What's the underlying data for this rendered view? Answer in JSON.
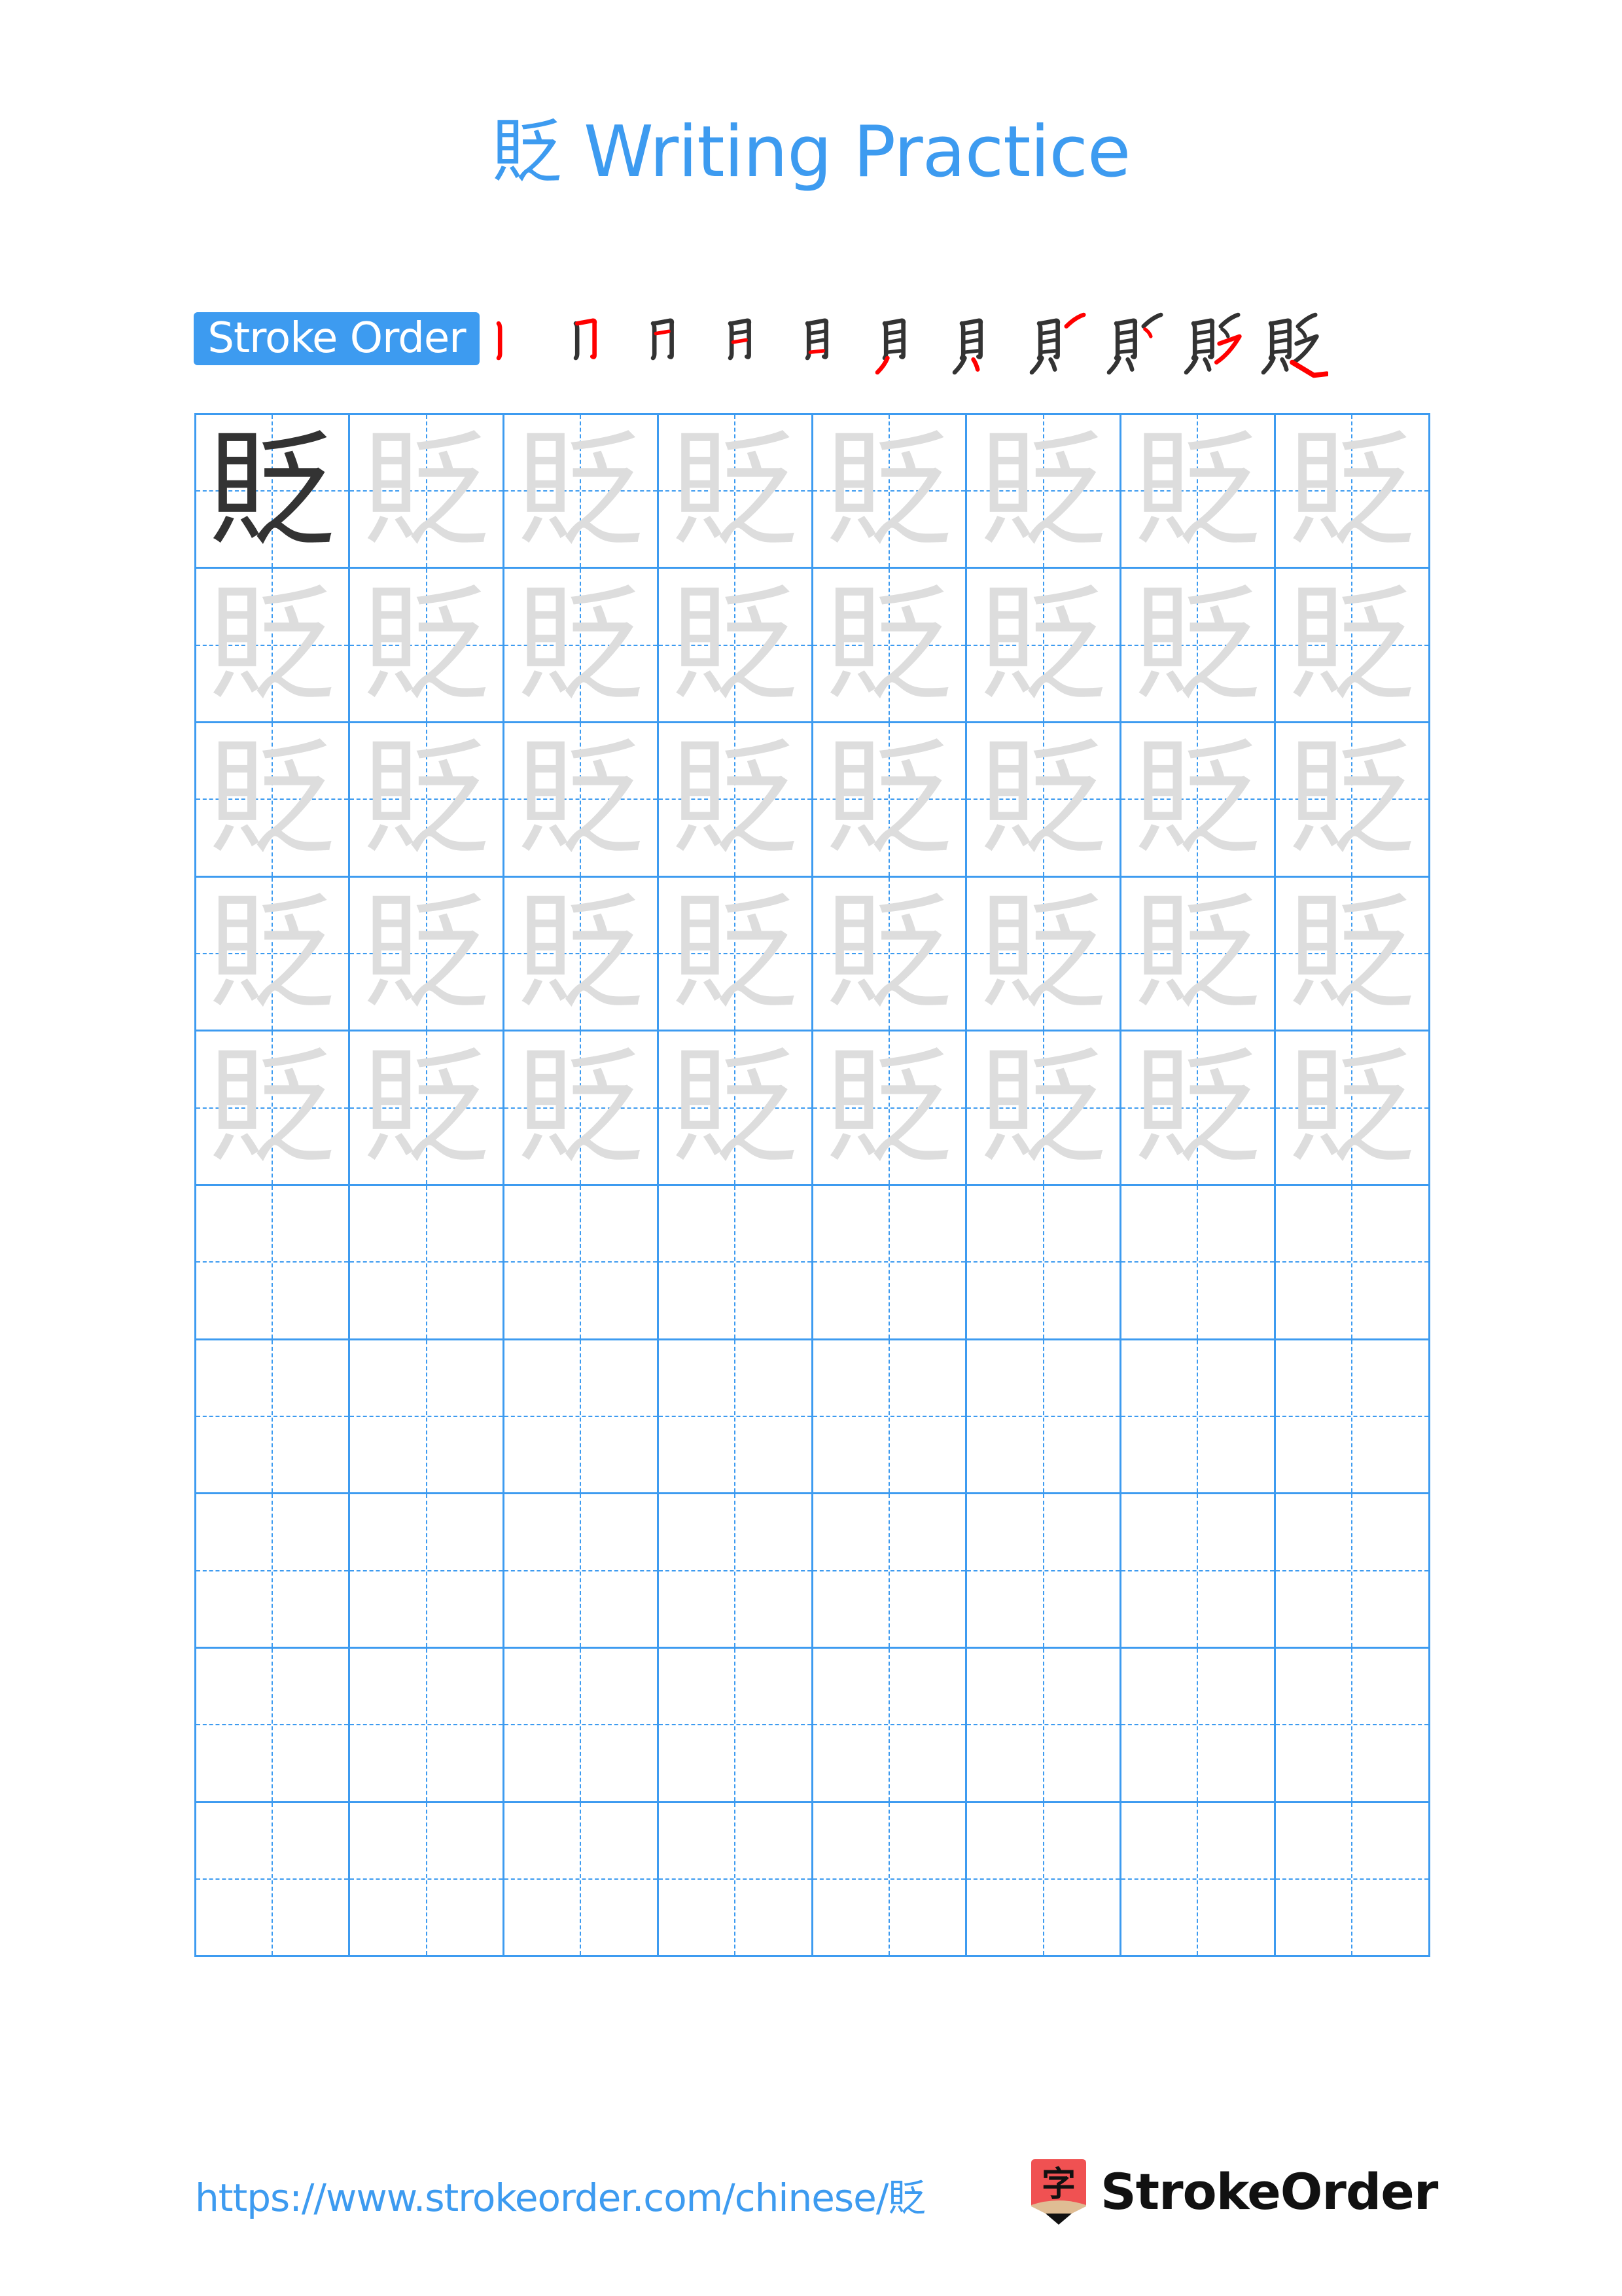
{
  "title": "貶 Writing Practice",
  "character": "貶",
  "stroke_order": {
    "label": "Stroke Order",
    "total_strokes": 11,
    "frames": [
      {
        "step": 1,
        "highlight_stroke": 1
      },
      {
        "step": 2,
        "highlight_stroke": 2
      },
      {
        "step": 3,
        "highlight_stroke": 3
      },
      {
        "step": 4,
        "highlight_stroke": 4
      },
      {
        "step": 5,
        "highlight_stroke": 5
      },
      {
        "step": 6,
        "highlight_stroke": 6
      },
      {
        "step": 7,
        "highlight_stroke": 7
      },
      {
        "step": 8,
        "highlight_stroke": 8
      },
      {
        "step": 9,
        "highlight_stroke": 9
      },
      {
        "step": 10,
        "highlight_stroke": 10
      },
      {
        "step": 11,
        "highlight_stroke": 11
      }
    ],
    "colors": {
      "done": "#333333",
      "current": "#ff0000"
    }
  },
  "grid": {
    "columns": 8,
    "rows": 10,
    "model_cells": 1,
    "trace_rows": 5,
    "empty_rows": 5,
    "colors": {
      "line": "#3d9bf0",
      "model": "#333333",
      "trace": "#dddddd"
    }
  },
  "footer": {
    "url": "https://www.strokeorder.com/chinese/貶",
    "brand": "StrokeOrder",
    "logo_glyph": "字",
    "logo_colors": {
      "body": "#f05152",
      "band": "#dfbd94",
      "tip": "#111111"
    }
  },
  "colors": {
    "accent": "#3d9bf0"
  }
}
